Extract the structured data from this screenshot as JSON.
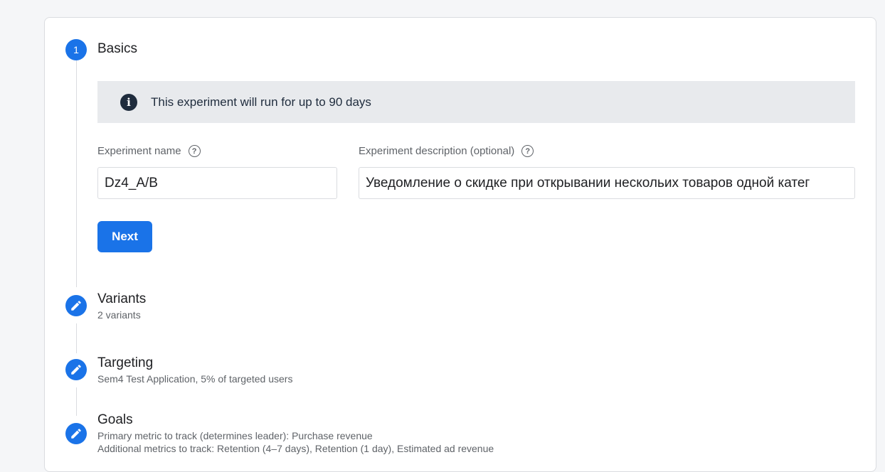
{
  "steps": [
    {
      "number": "1",
      "title": "Basics",
      "icon": "step-number"
    },
    {
      "title": "Variants",
      "subtitle": "2 variants",
      "icon": "edit-icon"
    },
    {
      "title": "Targeting",
      "subtitle": "Sem4 Test Application, 5% of targeted users",
      "icon": "edit-icon"
    },
    {
      "title": "Goals",
      "subtitle": "Primary metric to track (determines leader): Purchase revenue",
      "subtitle2": "Additional metrics to track: Retention (4–7 days), Retention (1 day), Estimated ad revenue",
      "icon": "edit-icon"
    }
  ],
  "banner": {
    "icon": "info-icon",
    "text": "This experiment will run for up to 90 days"
  },
  "form": {
    "name_label": "Experiment name",
    "name_value": "Dz4_A/B",
    "description_label": "Experiment description (optional)",
    "description_value": "Уведомление о скидке при открывании нескольих товаров одной катег",
    "next_label": "Next"
  },
  "colors": {
    "accent": "#1a73e8",
    "banner_bg": "#e8eaed",
    "banner_text": "#1f2c3d"
  }
}
